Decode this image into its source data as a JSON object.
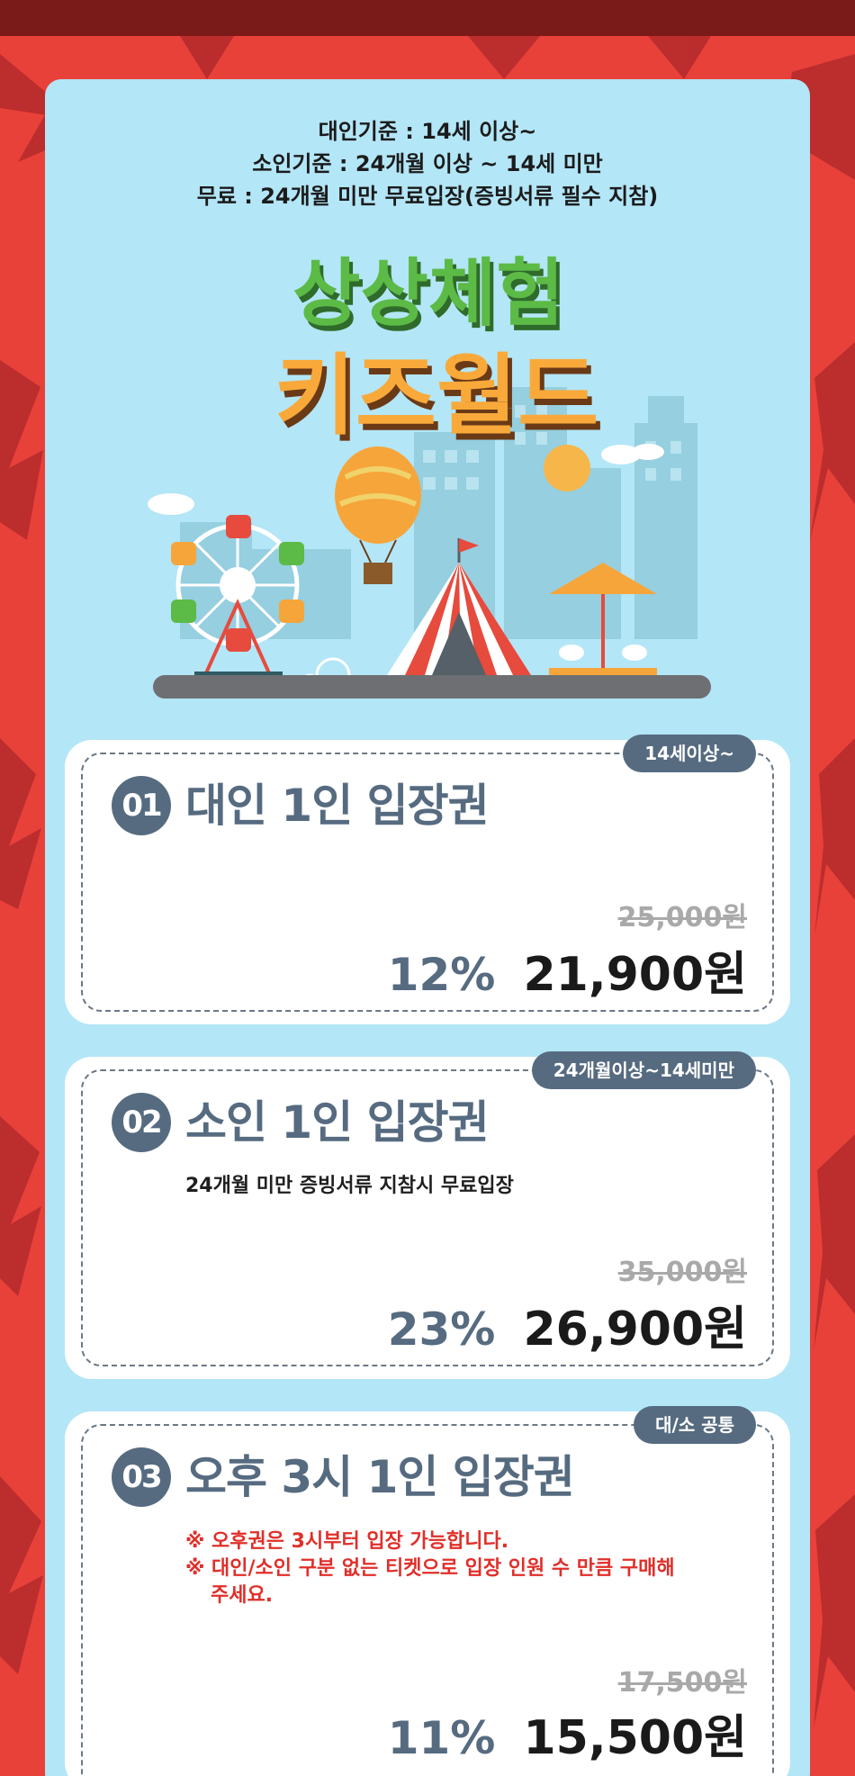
{
  "criteria": {
    "adult": "대인기준 : 14세 이상~",
    "child": "소인기준 : 24개월 이상 ~ 14세 미만",
    "free": "무료 : 24개월 미만 무료입장(증빙서류 필수 지참)"
  },
  "hero": {
    "line1": "상상체험",
    "line2": "키즈월드"
  },
  "tickets": [
    {
      "badge": "14세이상~",
      "number": "01",
      "title": "대인 1인 입장권",
      "original_price": "25,000원",
      "discount": "12%",
      "price": "21,900원"
    },
    {
      "badge": "24개월이상~14세미만",
      "number": "02",
      "title": "소인 1인 입장권",
      "note": "24개월 미만 증빙서류 지참시 무료입장",
      "original_price": "35,000원",
      "discount": "23%",
      "price": "26,900원"
    },
    {
      "badge": "대/소 공통",
      "number": "03",
      "title": "오후 3시 1인 입장권",
      "warning1": "※ 오후권은 3시부터 입장 가능합니다.",
      "warning2": "※ 대인/소인 구분 없는 티켓으로 입장 인원 수 만큼 구매해 주세요.",
      "original_price": "17,500원",
      "discount": "11%",
      "price": "15,500원"
    }
  ],
  "colors": {
    "background_red": "#e8413a",
    "panel_blue": "#b3e6f7",
    "slate": "#566b80",
    "warning_red": "#e02f2a"
  }
}
